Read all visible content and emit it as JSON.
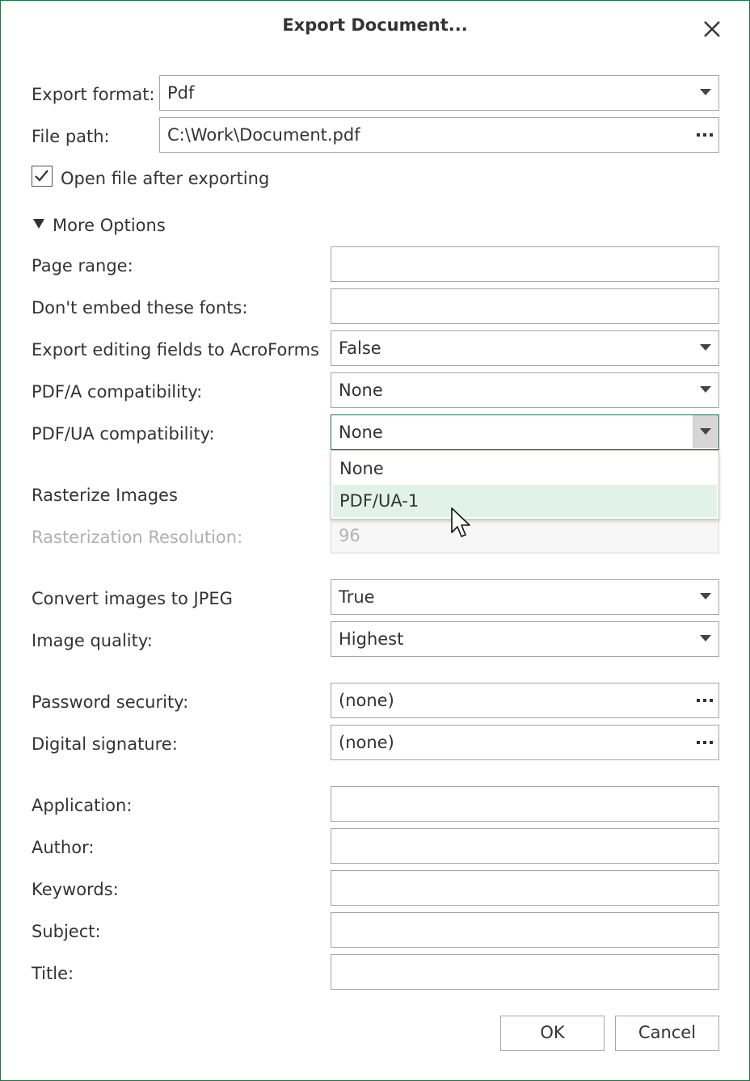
{
  "dialog": {
    "title": "Export Document...",
    "close_icon": "close-icon"
  },
  "basic": {
    "export_format_label": "Export format:",
    "export_format_value": "Pdf",
    "file_path_label": "File path:",
    "file_path_value": "C:\\Work\\Document.pdf",
    "open_after_label": "Open file after exporting",
    "open_after_checked": true
  },
  "more_options": {
    "label": "More Options",
    "expanded": true
  },
  "options": {
    "page_range_label": "Page range:",
    "page_range_value": "",
    "dont_embed_label": "Don't embed these fonts:",
    "dont_embed_value": "",
    "acroforms_label": "Export editing fields to AcroForms",
    "acroforms_value": "False",
    "pdfa_label": "PDF/A compatibility:",
    "pdfa_value": "None",
    "pdfua_label": "PDF/UA compatibility:",
    "pdfua_value": "None",
    "pdfua_options": [
      "None",
      "PDF/UA-1"
    ],
    "pdfua_hovered_option": "PDF/UA-1",
    "rasterize_label": "Rasterize Images",
    "raster_res_label": "Rasterization Resolution:",
    "raster_res_value": "96",
    "jpeg_label": "Convert images to JPEG",
    "jpeg_value": "True",
    "quality_label": "Image quality:",
    "quality_value": "Highest",
    "password_label": "Password security:",
    "password_value": "(none)",
    "signature_label": "Digital signature:",
    "signature_value": "(none)"
  },
  "metadata": {
    "application_label": "Application:",
    "application_value": "",
    "author_label": "Author:",
    "author_value": "",
    "keywords_label": "Keywords:",
    "keywords_value": "",
    "subject_label": "Subject:",
    "subject_value": "",
    "title_label": "Title:",
    "title_value": ""
  },
  "buttons": {
    "ok": "OK",
    "cancel": "Cancel"
  },
  "colors": {
    "accent": "#217346",
    "hover": "#e1f3e8",
    "border": "#a6a6a6",
    "disabled_text": "#b0b0b0"
  }
}
